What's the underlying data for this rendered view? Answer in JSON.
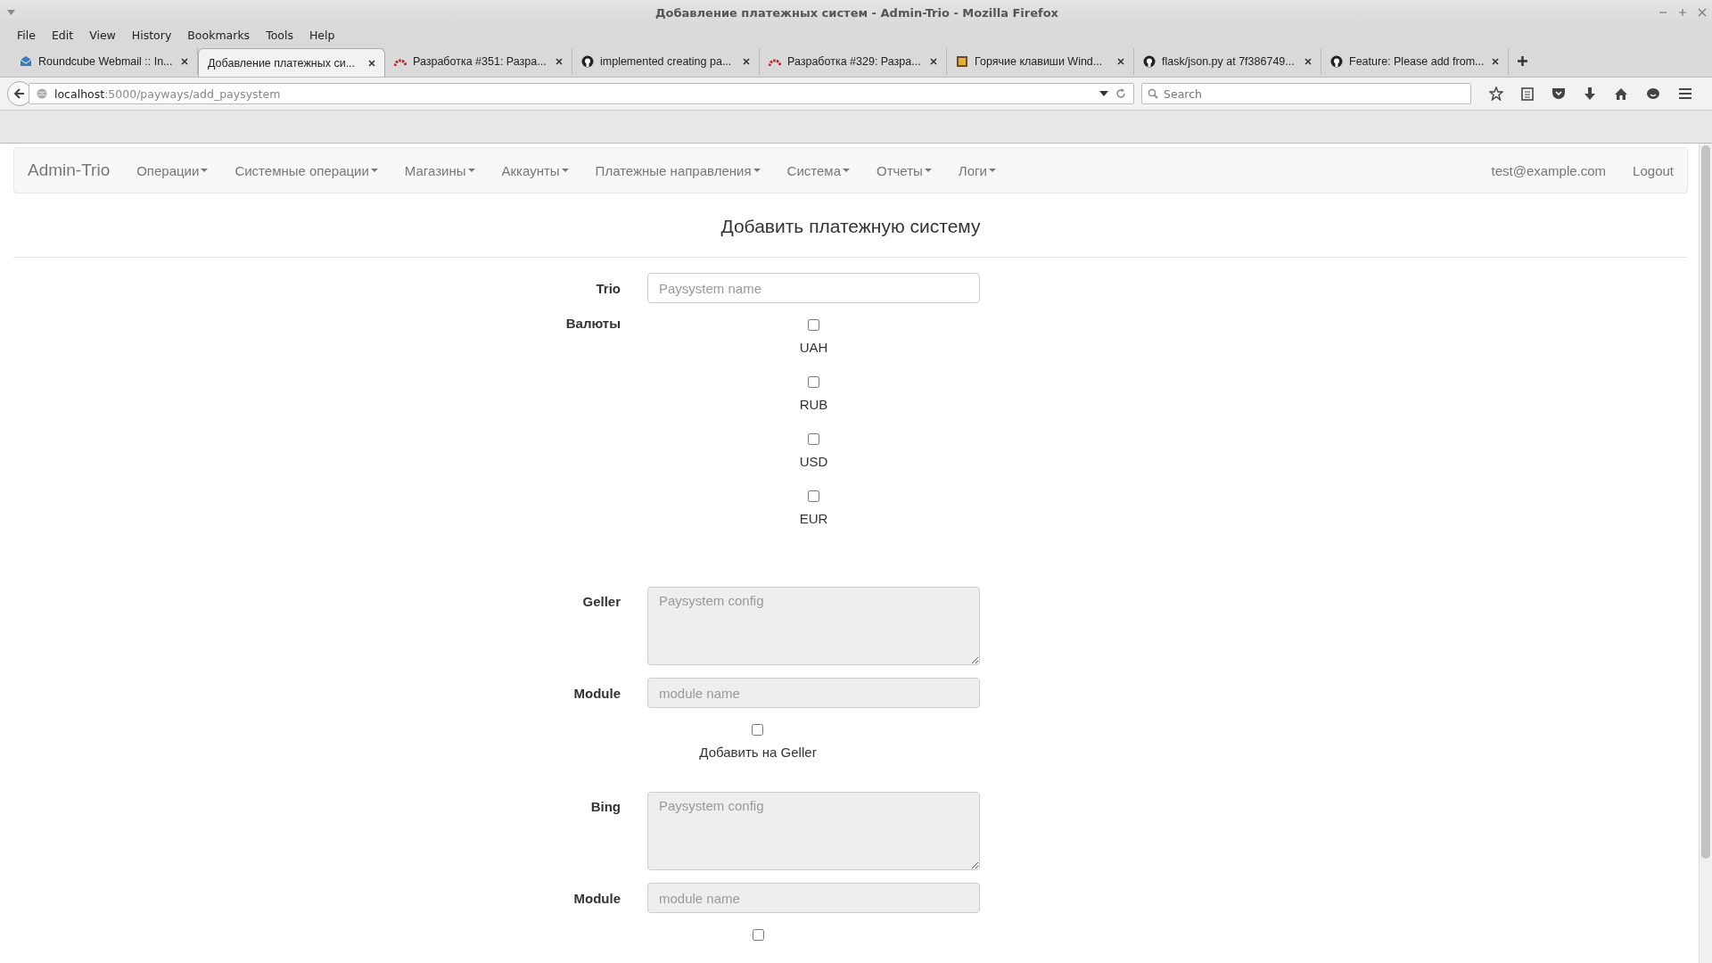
{
  "window": {
    "title": "Добавление платежных систем - Admin-Trio - Mozilla Firefox"
  },
  "menu": [
    "File",
    "Edit",
    "View",
    "History",
    "Bookmarks",
    "Tools",
    "Help"
  ],
  "tabs": [
    {
      "label": "Roundcube Webmail :: In...",
      "selected": false,
      "kind": "mail"
    },
    {
      "label": "Добавление платежных си...",
      "selected": true,
      "kind": "none"
    },
    {
      "label": "Разработка #351: Разра...",
      "selected": false,
      "kind": "redmine"
    },
    {
      "label": "implemented creating pa...",
      "selected": false,
      "kind": "github"
    },
    {
      "label": "Разработка #329: Разра...",
      "selected": false,
      "kind": "redmine"
    },
    {
      "label": "Горячие клавиши Wind...",
      "selected": false,
      "kind": "page"
    },
    {
      "label": "flask/json.py at 7f386749...",
      "selected": false,
      "kind": "github"
    },
    {
      "label": "Feature: Please add from...",
      "selected": false,
      "kind": "github"
    }
  ],
  "address": {
    "host": "localhost",
    "path": ":5000/payways/add_paysystem"
  },
  "search": {
    "placeholder": "Search"
  },
  "navbar": {
    "brand": "Admin-Trio",
    "items": [
      "Операции",
      "Системные операции",
      "Магазины",
      "Аккаунты",
      "Платежные направления",
      "Система",
      "Отчеты",
      "Логи"
    ],
    "user": "test@example.com",
    "logout": "Logout"
  },
  "heading": "Добавить платежную систему",
  "form": {
    "name": {
      "label": "Trio",
      "placeholder": "Paysystem name"
    },
    "currencies": {
      "label": "Валюты",
      "items": [
        {
          "label": "UAH",
          "checked": false
        },
        {
          "label": "RUB",
          "checked": false
        },
        {
          "label": "USD",
          "checked": false
        },
        {
          "label": "EUR",
          "checked": false
        }
      ]
    },
    "sections": [
      {
        "label": "Geller",
        "config_placeholder": "Paysystem config",
        "module_label": "Module",
        "module_placeholder": "module name",
        "add_label": "Добавить на Geller",
        "add_checked": false
      },
      {
        "label": "Bing",
        "config_placeholder": "Paysystem config",
        "module_label": "Module",
        "module_placeholder": "module name",
        "add_checked": false
      }
    ]
  }
}
